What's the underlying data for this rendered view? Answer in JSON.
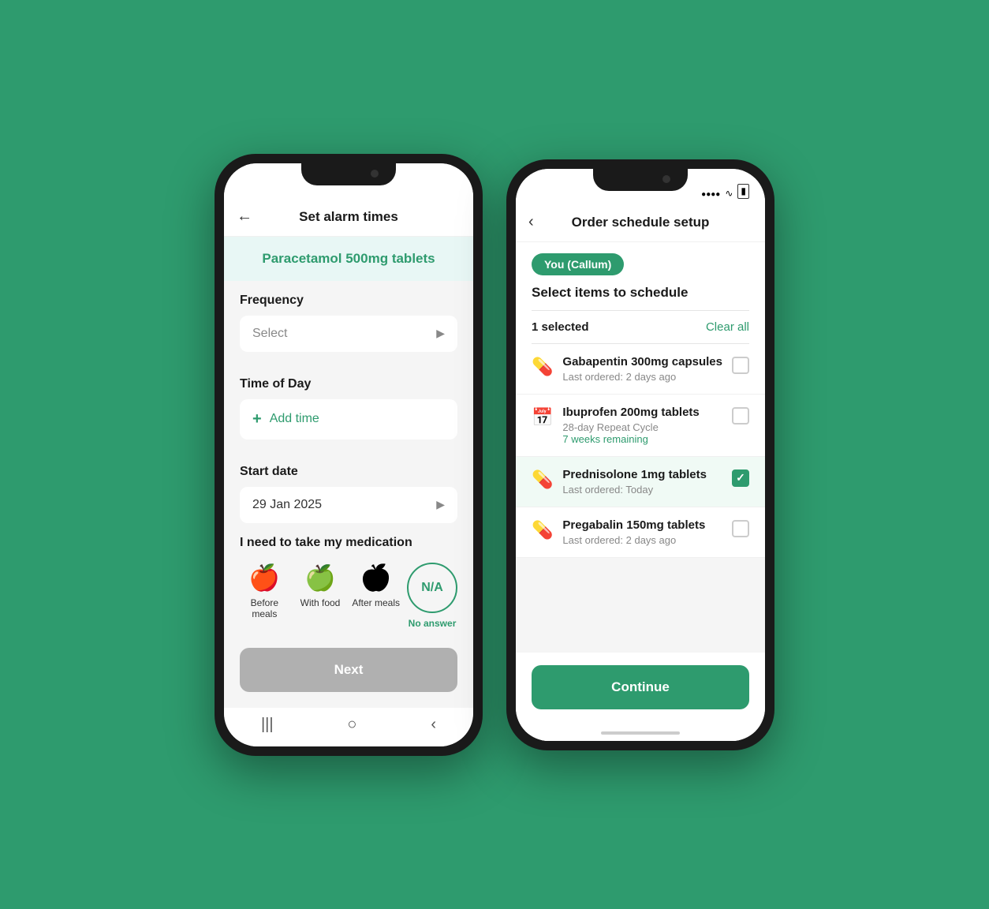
{
  "background_color": "#2e9b6e",
  "phone1": {
    "nav": {
      "back_label": "←",
      "title": "Set alarm times"
    },
    "med_name": "Paracetamol 500mg tablets",
    "frequency": {
      "label": "Frequency",
      "placeholder": "Select"
    },
    "time_of_day": {
      "label": "Time of Day",
      "add_time_label": "Add time"
    },
    "start_date": {
      "label": "Start date",
      "value": "29 Jan 2025"
    },
    "medication_timing": {
      "label": "I need to take my medication",
      "options": [
        {
          "id": "before-meals",
          "icon": "🍎",
          "label": "Before meals",
          "selected": false
        },
        {
          "id": "with-food",
          "icon": "🍏",
          "label": "With food",
          "selected": false
        },
        {
          "id": "after-meals",
          "icon": "🍎",
          "label": "After meals",
          "selected": false
        },
        {
          "id": "no-answer",
          "icon": "N/A",
          "label": "No answer",
          "selected": true
        }
      ]
    },
    "next_button_label": "Next",
    "bottom_bar": [
      "|||",
      "○",
      "<"
    ]
  },
  "phone2": {
    "nav": {
      "back_label": "‹",
      "title": "Order schedule setup"
    },
    "user_badge": "You (Callum)",
    "section_title": "Select items to schedule",
    "selection": {
      "count_label": "1 selected",
      "clear_all_label": "Clear all"
    },
    "medications": [
      {
        "name": "Gabapentin 300mg capsules",
        "sub": "Last ordered: 2 days ago",
        "sub_green": "",
        "selected": false,
        "icon": "💊"
      },
      {
        "name": "Ibuprofen 200mg tablets",
        "sub": "28-day Repeat Cycle",
        "sub_green": "7 weeks remaining",
        "selected": false,
        "icon": "🗓"
      },
      {
        "name": "Prednisolone 1mg tablets",
        "sub": "Last ordered: Today",
        "sub_green": "",
        "selected": true,
        "icon": "💊"
      },
      {
        "name": "Pregabalin 150mg tablets",
        "sub": "Last ordered: 2 days ago",
        "sub_green": "",
        "selected": false,
        "icon": "💊"
      }
    ],
    "continue_button_label": "Continue",
    "status_bar": {
      "wifi": "wifi",
      "battery": "battery"
    }
  }
}
